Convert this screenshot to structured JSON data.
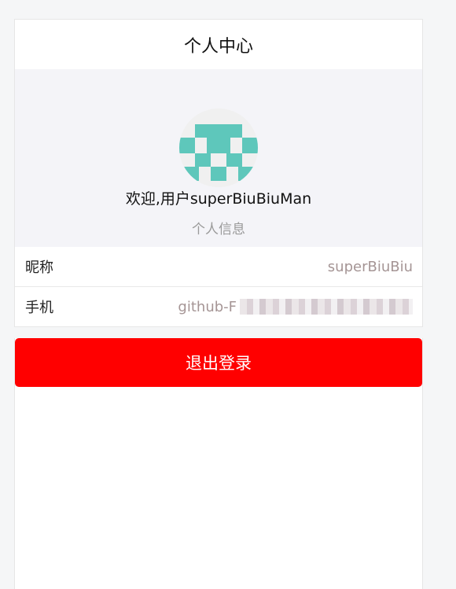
{
  "header": {
    "title": "个人中心"
  },
  "profile": {
    "welcome": "欢迎,用户superBiuBiuMan",
    "info_label": "个人信息",
    "avatar_color": "#5ec7bb"
  },
  "rows": [
    {
      "label": "昵称",
      "value": "superBiuBiu"
    },
    {
      "label": "手机",
      "value": "github-F"
    }
  ],
  "logout": {
    "label": "退出登录",
    "color": "#ff0000"
  }
}
